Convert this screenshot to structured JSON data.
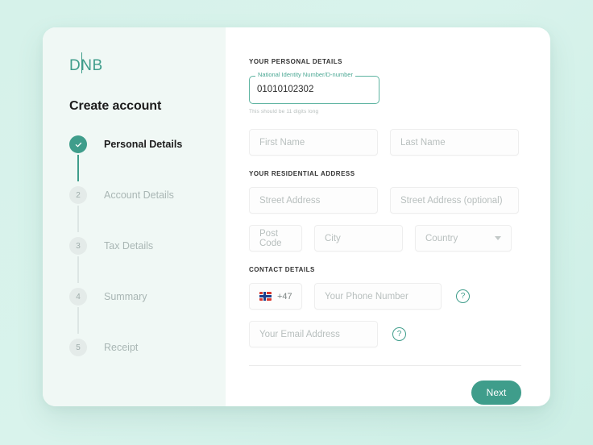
{
  "brand": {
    "logo_text_d": "D",
    "logo_text_nb": "NB",
    "accent_color": "#3f9d8b"
  },
  "sidebar": {
    "title": "Create account",
    "steps": [
      {
        "marker": "✓",
        "label": "Personal Details",
        "state": "completed"
      },
      {
        "marker": "2",
        "label": "Account Details",
        "state": "pending"
      },
      {
        "marker": "3",
        "label": "Tax Details",
        "state": "pending"
      },
      {
        "marker": "4",
        "label": "Summary",
        "state": "pending"
      },
      {
        "marker": "5",
        "label": "Receipt",
        "state": "pending"
      }
    ]
  },
  "form": {
    "personal_heading": "YOUR PERSONAL DETAILS",
    "national_id": {
      "label": "National Identity Number/D-number",
      "value": "01010102302",
      "helper": "This should be 11 digits long"
    },
    "first_name_placeholder": "First Name",
    "last_name_placeholder": "Last Name",
    "address_heading": "YOUR RESIDENTIAL ADDRESS",
    "street_address_placeholder": "Street Address",
    "street_address_2_placeholder": "Street Address (optional)",
    "post_code_placeholder": "Post Code",
    "city_placeholder": "City",
    "country_placeholder": "Country",
    "contact_heading": "CONTACT DETAILS",
    "country_code": "+47",
    "phone_placeholder": "Your Phone Number",
    "email_placeholder": "Your Email Address",
    "help_glyph": "?",
    "next_label": "Next"
  }
}
